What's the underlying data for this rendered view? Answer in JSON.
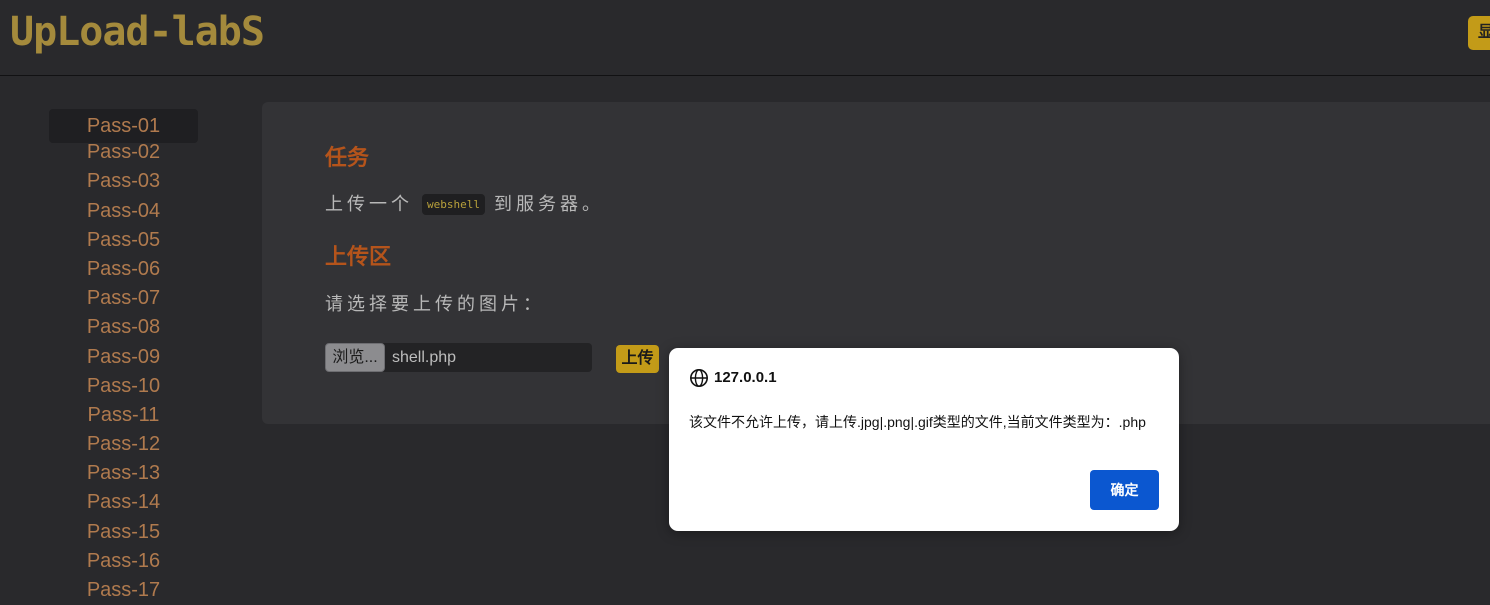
{
  "header": {
    "logo": "UpLoad-labS",
    "right_button": "显"
  },
  "sidebar": {
    "items": [
      {
        "label": "Pass-01"
      },
      {
        "label": "Pass-02"
      },
      {
        "label": "Pass-03"
      },
      {
        "label": "Pass-04"
      },
      {
        "label": "Pass-05"
      },
      {
        "label": "Pass-06"
      },
      {
        "label": "Pass-07"
      },
      {
        "label": "Pass-08"
      },
      {
        "label": "Pass-09"
      },
      {
        "label": "Pass-10"
      },
      {
        "label": "Pass-11"
      },
      {
        "label": "Pass-12"
      },
      {
        "label": "Pass-13"
      },
      {
        "label": "Pass-14"
      },
      {
        "label": "Pass-15"
      },
      {
        "label": "Pass-16"
      },
      {
        "label": "Pass-17"
      }
    ]
  },
  "main": {
    "task_heading": "任务",
    "task_prefix": "上传一个",
    "task_code": "webshell",
    "task_suffix": "到服务器。",
    "upload_heading": "上传区",
    "choose_label": "请选择要上传的图片：",
    "browse_label": "浏览...",
    "file_name": "shell.php",
    "upload_button": "上传"
  },
  "dialog": {
    "icon": "globe-icon",
    "title": "127.0.0.1",
    "message": "该文件不允许上传，请上传.jpg|.png|.gif类型的文件,当前文件类型为：.php",
    "ok_label": "确定"
  },
  "colors": {
    "background": "#29292c",
    "panel": "#333336",
    "accent_gold": "#c39b18",
    "heading_orange": "#b5541b",
    "sidebar_link": "#b07a4e",
    "dialog_button": "#0b57d0"
  }
}
